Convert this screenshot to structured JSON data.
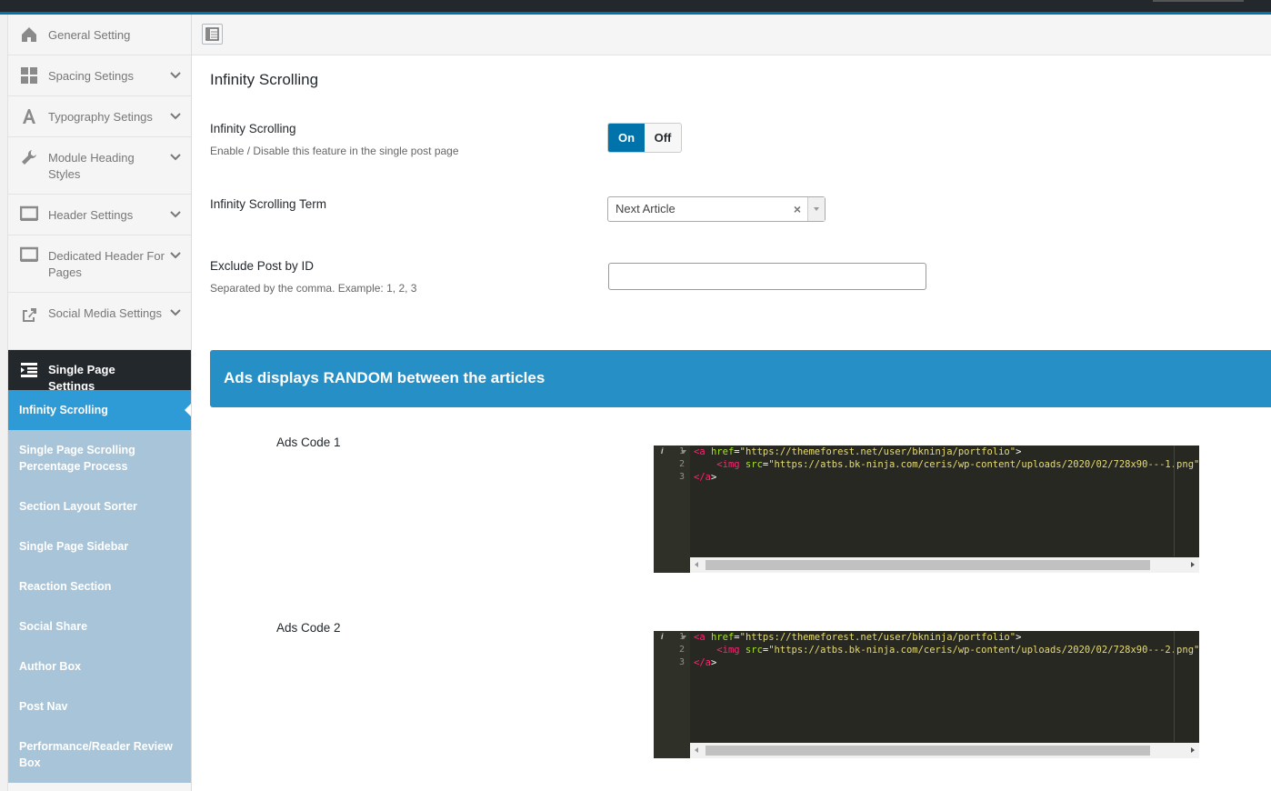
{
  "sidebar": {
    "items": [
      {
        "label": "General Setting",
        "icon": "home-icon"
      },
      {
        "label": "Spacing Setings",
        "icon": "grid-icon"
      },
      {
        "label": "Typography Setings",
        "icon": "typography-icon"
      },
      {
        "label": "Module Heading Styles",
        "icon": "wrench-icon"
      },
      {
        "label": "Header Settings",
        "icon": "monitor-icon"
      },
      {
        "label": "Dedicated Header For Pages",
        "icon": "monitor-icon"
      },
      {
        "label": "Social Media Settings",
        "icon": "share-icon"
      },
      {
        "label": "Single Page Settings",
        "icon": "list-icon"
      }
    ],
    "subitems": [
      {
        "label": "Infinity Scrolling"
      },
      {
        "label": "Single Page Scrolling Percentage Process"
      },
      {
        "label": "Section Layout Sorter"
      },
      {
        "label": "Single Page Sidebar"
      },
      {
        "label": "Reaction Section"
      },
      {
        "label": "Social Share"
      },
      {
        "label": "Author Box"
      },
      {
        "label": "Post Nav"
      },
      {
        "label": "Performance/Reader Review Box"
      }
    ]
  },
  "main": {
    "section_title": "Infinity Scrolling",
    "infinity": {
      "label": "Infinity Scrolling",
      "desc": "Enable / Disable this feature in the single post page",
      "on_label": "On",
      "off_label": "Off",
      "value": "On"
    },
    "term": {
      "label": "Infinity Scrolling Term",
      "value": "Next Article",
      "clear": "×"
    },
    "exclude": {
      "label": "Exclude Post by ID",
      "desc": "Separated by the comma. Example: 1, 2, 3",
      "value": ""
    },
    "banner": "Ads displays RANDOM between the articles",
    "ads": [
      {
        "label": "Ads Code 1",
        "lines": [
          "1",
          "2",
          "3"
        ],
        "href": "https://themeforest.net/user/bkninja/portfolio",
        "src": "https://atbs.bk-ninja.com/ceris/wp-content/uploads/2020/02/728x90---1.png"
      },
      {
        "label": "Ads Code 2",
        "lines": [
          "1",
          "2",
          "3"
        ],
        "href": "https://themeforest.net/user/bkninja/portfolio",
        "src": "https://atbs.bk-ninja.com/ceris/wp-content/uploads/2020/02/728x90---2.png"
      }
    ]
  },
  "colors": {
    "accent": "#0073aa",
    "banner": "#2690c6",
    "submenu": "#a8c4d8",
    "submenu_active": "#2e9bd6",
    "editor_bg": "#272822"
  }
}
